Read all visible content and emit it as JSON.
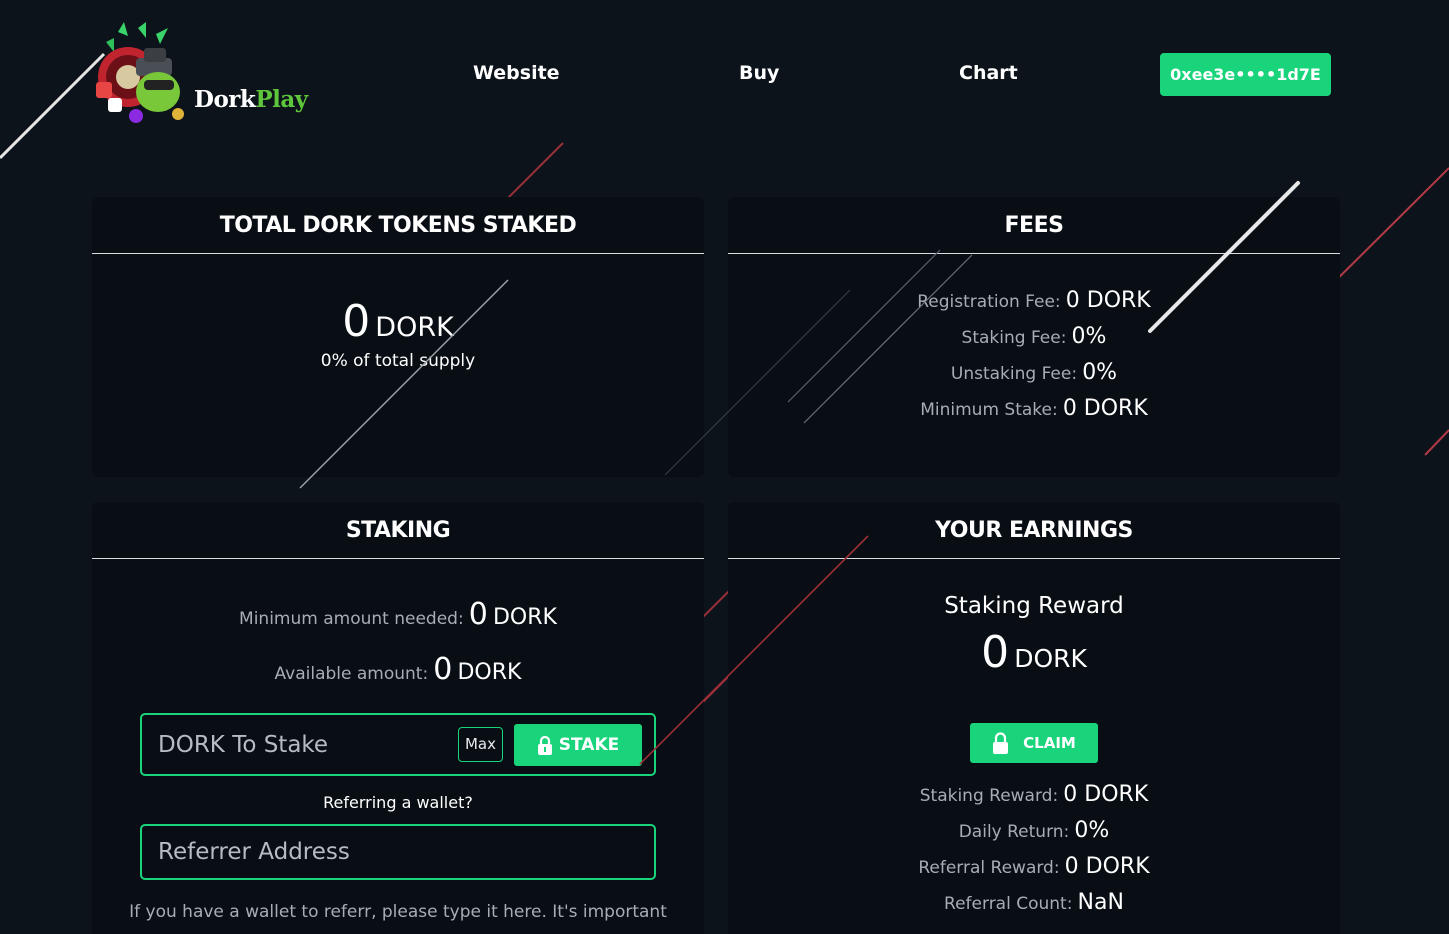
{
  "brand": {
    "name_part1": "Dork",
    "name_part2": "Play"
  },
  "nav": {
    "website": "Website",
    "buy": "Buy",
    "chart": "Chart",
    "wallet": "0xee3e••••1d7E"
  },
  "total_staked": {
    "title": "TOTAL DORK TOKENS STAKED",
    "amount": "0",
    "unit": "DORK",
    "supply_text": "0% of total supply"
  },
  "fees": {
    "title": "FEES",
    "rows": [
      {
        "label": "Registration Fee:",
        "value": "0 DORK"
      },
      {
        "label": "Staking Fee:",
        "value": "0%"
      },
      {
        "label": "Unstaking Fee:",
        "value": "0%"
      },
      {
        "label": "Minimum Stake:",
        "value": "0 DORK"
      }
    ]
  },
  "staking": {
    "title": "STAKING",
    "min_label": "Minimum amount needed:",
    "min_value": "0",
    "min_unit": "DORK",
    "avail_label": "Available amount:",
    "avail_value": "0",
    "avail_unit": "DORK",
    "stake_placeholder": "DORK To Stake",
    "max_label": "Max",
    "stake_button": "STAKE",
    "referring_label": "Referring a wallet?",
    "referrer_placeholder": "Referrer Address",
    "note": "If you have a wallet to referr, please type it here. It's important"
  },
  "earnings": {
    "title": "YOUR EARNINGS",
    "reward_title": "Staking Reward",
    "reward_amount": "0",
    "reward_unit": "DORK",
    "claim_button": "CLAIM",
    "rows": [
      {
        "label": "Staking Reward:",
        "value": "0 DORK"
      },
      {
        "label": "Daily Return:",
        "value": "0%"
      },
      {
        "label": "Referral Reward:",
        "value": "0 DORK"
      },
      {
        "label": "Referral Count:",
        "value": "NaN"
      }
    ]
  },
  "colors": {
    "accent": "#19d47b",
    "background": "#0c131b",
    "card": "#080e14",
    "brand_green": "#5ec63a"
  }
}
